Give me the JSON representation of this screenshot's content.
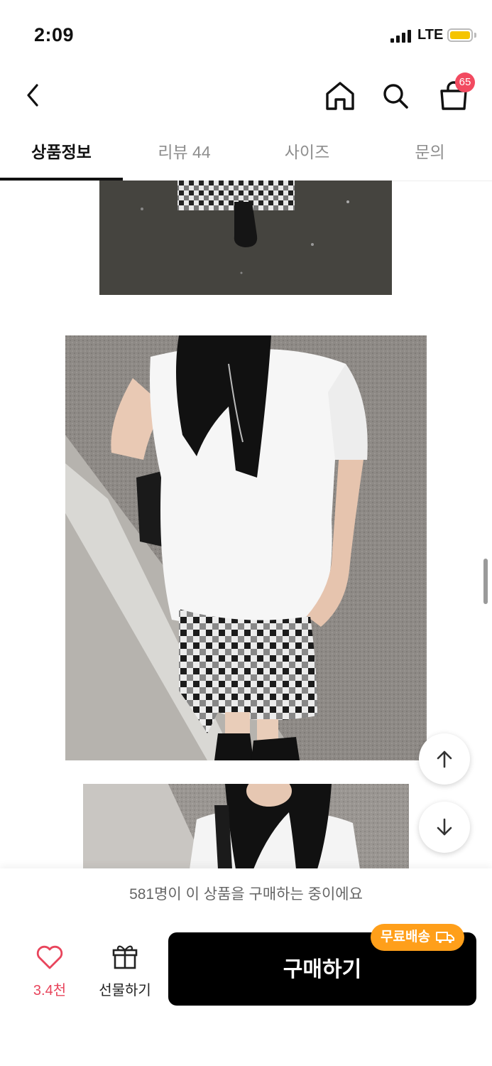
{
  "status_bar": {
    "time": "2:09",
    "network": "LTE"
  },
  "nav": {
    "cart_count": "65"
  },
  "tabs": [
    {
      "label": "상품정보"
    },
    {
      "label": "리뷰 44"
    },
    {
      "label": "사이즈"
    },
    {
      "label": "문의"
    }
  ],
  "bottom_bar": {
    "buying_now": "581명이 이 상품을 구매하는 중이에요",
    "like_count": "3.4천",
    "gift_label": "선물하기",
    "buy_label": "구매하기",
    "free_shipping_badge": "무료배송"
  },
  "colors": {
    "accent_red": "#f24a60",
    "buy_button": "#000000",
    "free_shipping": "#ff9f1a"
  }
}
